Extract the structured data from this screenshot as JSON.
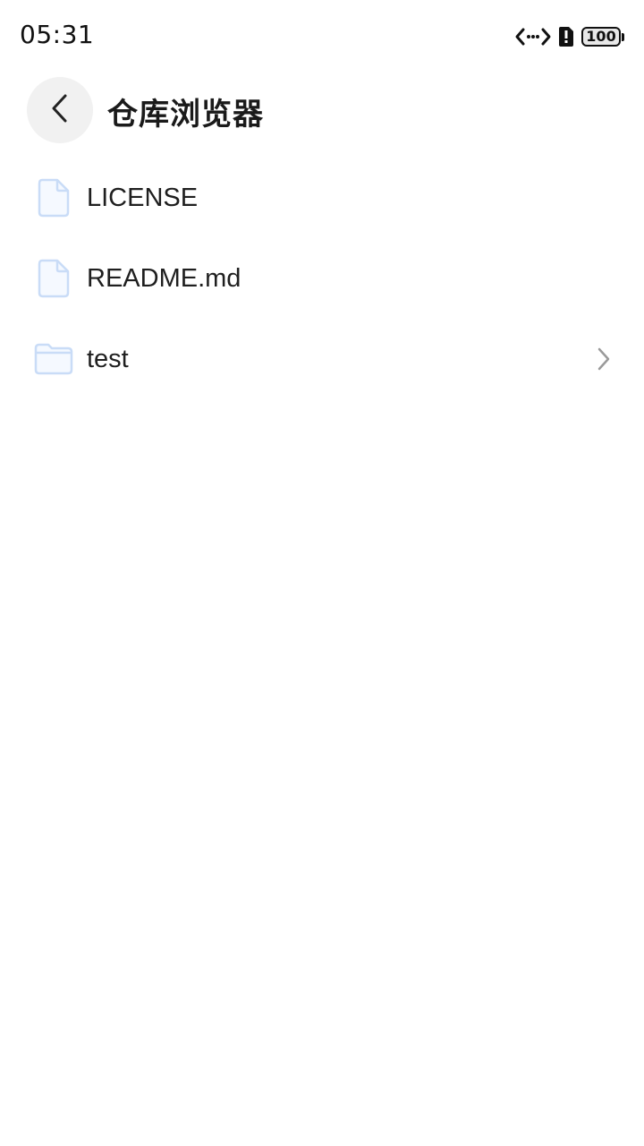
{
  "status_bar": {
    "time": "05:31",
    "icons": [
      "data-transfer-icon",
      "alert-sim-icon"
    ],
    "battery": "100"
  },
  "header": {
    "title": "仓库浏览器",
    "back_icon": "chevron-left-icon"
  },
  "files": [
    {
      "name": "LICENSE",
      "type": "file",
      "icon": "file-icon"
    },
    {
      "name": "README.md",
      "type": "file",
      "icon": "file-icon"
    },
    {
      "name": "test",
      "type": "folder",
      "icon": "folder-icon",
      "has_chevron": true
    }
  ],
  "colors": {
    "icon_stroke": "#c9dcf7",
    "icon_fill": "#f5f9ff",
    "chevron": "#9a9a9a",
    "back_button_bg": "#f1f1f1"
  }
}
